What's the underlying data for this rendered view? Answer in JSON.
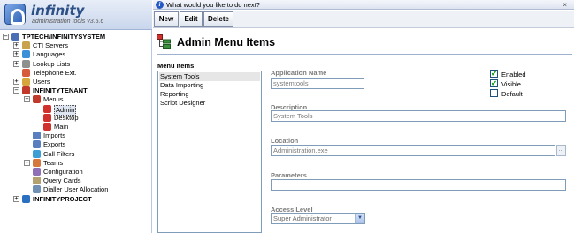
{
  "app": {
    "name": "infinity",
    "version": "administration tools v3.5.6"
  },
  "tree": [
    {
      "label": "TPTECH/INFINITYSYSTEM",
      "bold": true,
      "expander": "−",
      "icon": "server-icon",
      "color": "#4a6fb5",
      "level": 0
    },
    {
      "label": "CTI Servers",
      "expander": "+",
      "icon": "cti-servers-icon",
      "color": "#c9a24d",
      "level": 1
    },
    {
      "label": "Languages",
      "expander": "+",
      "icon": "languages-icon",
      "color": "#3b8fd6",
      "level": 1
    },
    {
      "label": "Lookup Lists",
      "expander": "+",
      "icon": "lookup-lists-icon",
      "color": "#8f8f8f",
      "level": 1
    },
    {
      "label": "Telephone Ext.",
      "expander": "",
      "icon": "telephone-icon",
      "color": "#d65a3b",
      "level": 1
    },
    {
      "label": "Users",
      "expander": "+",
      "icon": "users-icon",
      "color": "#d6a53b",
      "level": 1
    },
    {
      "label": "INFINITYTENANT",
      "bold": true,
      "expander": "−",
      "icon": "tenant-icon",
      "color": "#c0392b",
      "level": 1
    },
    {
      "label": "Menus",
      "expander": "−",
      "icon": "menus-icon",
      "color": "#c0392b",
      "level": 2
    },
    {
      "label": "Admin",
      "expander": "",
      "icon": "menu-item-icon",
      "color": "#d0312d",
      "level": 3,
      "selected": true
    },
    {
      "label": "Desktop",
      "expander": "",
      "icon": "menu-item-icon",
      "color": "#d0312d",
      "level": 3
    },
    {
      "label": "Main",
      "expander": "",
      "icon": "menu-item-icon",
      "color": "#d0312d",
      "level": 3
    },
    {
      "label": "Imports",
      "expander": "",
      "icon": "imports-icon",
      "color": "#5a7fc0",
      "level": 2
    },
    {
      "label": "Exports",
      "expander": "",
      "icon": "exports-icon",
      "color": "#5a7fc0",
      "level": 2
    },
    {
      "label": "Call Filters",
      "expander": "",
      "icon": "call-filters-icon",
      "color": "#3b9fd6",
      "level": 2
    },
    {
      "label": "Teams",
      "expander": "+",
      "icon": "teams-icon",
      "color": "#d6773b",
      "level": 2
    },
    {
      "label": "Configuration",
      "expander": "",
      "icon": "configuration-icon",
      "color": "#8f6fb5",
      "level": 2
    },
    {
      "label": "Query Cards",
      "expander": "",
      "icon": "query-cards-icon",
      "color": "#b5a06f",
      "level": 2
    },
    {
      "label": "Dialler User Allocation",
      "expander": "",
      "icon": "dialler-icon",
      "color": "#6f8fb5",
      "level": 2
    },
    {
      "label": "INFINITYPROJECT",
      "bold": true,
      "expander": "+",
      "icon": "project-icon",
      "color": "#2b6fc0",
      "level": 1
    }
  ],
  "question_bar": {
    "text": "What would you like to do next?",
    "close": "×"
  },
  "toolbar": {
    "new_label": "New",
    "edit_label": "Edit",
    "delete_label": "Delete"
  },
  "page": {
    "title": "Admin Menu Items"
  },
  "menu_items": {
    "label": "Menu Items",
    "items": [
      "System Tools",
      "Data Importing",
      "Reporting",
      "Script Designer"
    ],
    "selected_index": 0
  },
  "form": {
    "application_name_label": "Application Name",
    "application_name_value": "systemtools",
    "description_label": "Description",
    "description_value": "System Tools",
    "location_label": "Location",
    "location_value": "Administration.exe",
    "browse_label": "...",
    "parameters_label": "Parameters",
    "parameters_value": "",
    "access_level_label": "Access Level",
    "access_level_value": "Super Administrator",
    "select_arrow": "▼"
  },
  "checkboxes": [
    {
      "label": "Enabled",
      "checked": true
    },
    {
      "label": "Visible",
      "checked": true
    },
    {
      "label": "Default",
      "checked": false
    }
  ],
  "check_mark": "✔"
}
